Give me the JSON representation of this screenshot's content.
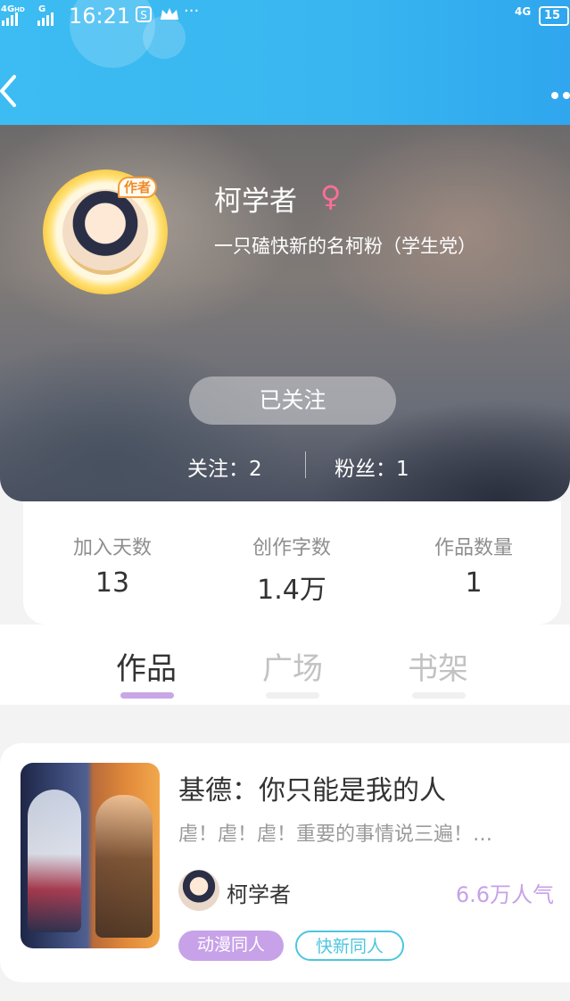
{
  "status_bar": {
    "signal1": "4G",
    "signal1_sup": "HD",
    "signal2": "G",
    "time": "16:21",
    "network_right": "4G",
    "battery": "15"
  },
  "profile": {
    "avatar_tag": "作者",
    "name": "柯学者",
    "gender_symbol": "♀",
    "bio": "一只磕快新的名柯粉（学生党）",
    "follow_button": "已关注",
    "following_text": "关注：2",
    "fans_text": "粉丝：1"
  },
  "stats": [
    {
      "label": "加入天数",
      "value": "13"
    },
    {
      "label": "创作字数",
      "value": "1.4万"
    },
    {
      "label": "作品数量",
      "value": "1"
    }
  ],
  "tabs": [
    {
      "label": "作品",
      "active": true
    },
    {
      "label": "广场",
      "active": false
    },
    {
      "label": "书架",
      "active": false
    }
  ],
  "work": {
    "title": "基德：你只能是我的人",
    "summary": "虐！虐！虐！重要的事情说三遍！…",
    "author": "柯学者",
    "popularity": "6.6万人气",
    "tags": [
      "动漫同人",
      "快新同人"
    ]
  },
  "colors": {
    "header_blue": "#39b6f0",
    "accent_purple": "#c7a2e8",
    "tag_cyan": "#4cc6df",
    "gender_pink": "#ff6e97"
  }
}
